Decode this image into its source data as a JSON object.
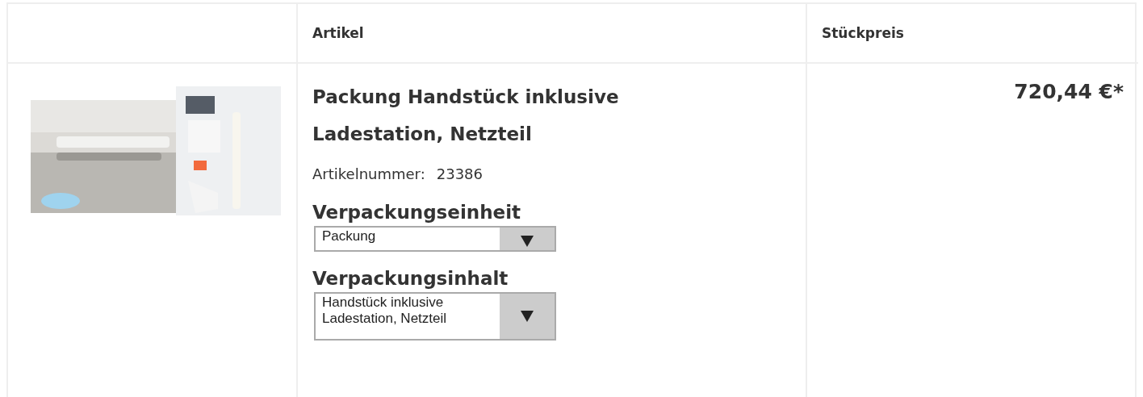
{
  "table": {
    "columns": [
      "Artikel",
      "Stückpreis"
    ],
    "rows": [
      {
        "title": "Packung Handstück inklusive Ladestation, Netzteil",
        "article_number_label": "Artikelnummer:",
        "article_number": "23386",
        "options": [
          {
            "label": "Verpackungseinheit",
            "value": "Packung"
          },
          {
            "label": "Verpackungsinhalt",
            "value": "Handstück inklusive Ladestation, Netzteil"
          }
        ],
        "unit_price": "720,44 €*"
      }
    ]
  }
}
